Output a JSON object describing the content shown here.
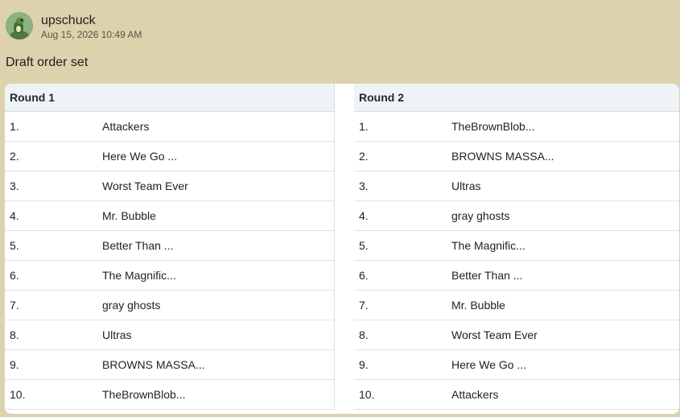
{
  "post": {
    "username": "upschuck",
    "timestamp": "Aug 15, 2026 10:49 AM",
    "message": "Draft order set"
  },
  "rounds": [
    {
      "title": "Round 1",
      "picks": [
        {
          "num": "1.",
          "team": "Attackers"
        },
        {
          "num": "2.",
          "team": "Here We Go ..."
        },
        {
          "num": "3.",
          "team": "Worst Team Ever"
        },
        {
          "num": "4.",
          "team": "Mr. Bubble"
        },
        {
          "num": "5.",
          "team": "Better Than ..."
        },
        {
          "num": "6.",
          "team": "The Magnific..."
        },
        {
          "num": "7.",
          "team": "gray ghosts"
        },
        {
          "num": "8.",
          "team": "Ultras"
        },
        {
          "num": "9.",
          "team": "BROWNS MASSA..."
        },
        {
          "num": "10.",
          "team": "TheBrownBlob..."
        }
      ]
    },
    {
      "title": "Round 2",
      "picks": [
        {
          "num": "1.",
          "team": "TheBrownBlob..."
        },
        {
          "num": "2.",
          "team": "BROWNS MASSA..."
        },
        {
          "num": "3.",
          "team": "Ultras"
        },
        {
          "num": "4.",
          "team": "gray ghosts"
        },
        {
          "num": "5.",
          "team": "The Magnific..."
        },
        {
          "num": "6.",
          "team": "Better Than ..."
        },
        {
          "num": "7.",
          "team": "Mr. Bubble"
        },
        {
          "num": "8.",
          "team": "Worst Team Ever"
        },
        {
          "num": "9.",
          "team": "Here We Go ..."
        },
        {
          "num": "10.",
          "team": "Attackers"
        }
      ]
    }
  ],
  "colors": {
    "page_background": "#dcd2ad",
    "table_header": "#f0f3f5",
    "card": "#ffffff"
  }
}
